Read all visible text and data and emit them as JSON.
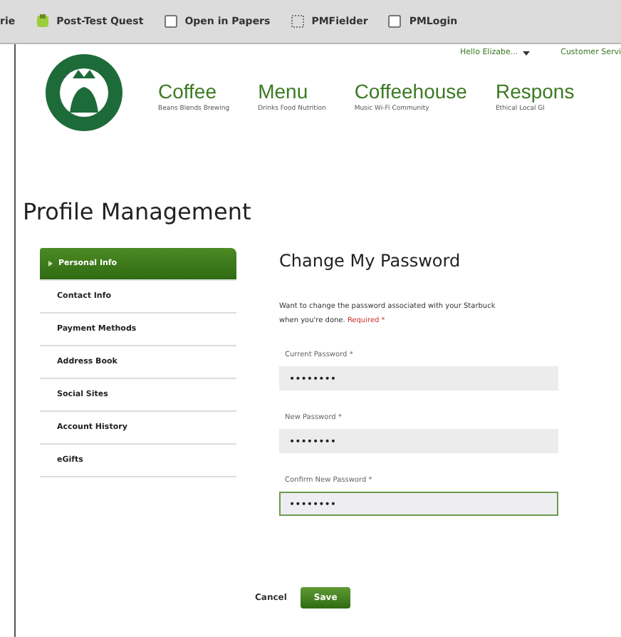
{
  "bookmarks_bar": [
    {
      "label": "rie",
      "kind": "plain"
    },
    {
      "label": "Post-Test Quest",
      "kind": "app"
    },
    {
      "label": "Open in Papers",
      "kind": "page"
    },
    {
      "label": "PMFielder",
      "kind": "dotted"
    },
    {
      "label": "PMLogin",
      "kind": "page"
    }
  ],
  "header": {
    "user_menu": "Hello Elizabe...",
    "customer_service": "Customer Servi",
    "nav": [
      {
        "title": "Coffee",
        "subtitle": "Beans Blends Brewing"
      },
      {
        "title": "Menu",
        "subtitle": "Drinks Food Nutrition"
      },
      {
        "title": "Coffeehouse",
        "subtitle": "Music Wi-Fi Community"
      },
      {
        "title": "Respons",
        "subtitle": "Ethical Local Gl"
      }
    ]
  },
  "page_title": "Profile Management",
  "sidebar": {
    "items": [
      {
        "label": "Personal Info",
        "selected": true
      },
      {
        "label": "Contact Info",
        "selected": false
      },
      {
        "label": "Payment Methods",
        "selected": false
      },
      {
        "label": "Address Book",
        "selected": false
      },
      {
        "label": "Social Sites",
        "selected": false
      },
      {
        "label": "Account History",
        "selected": false
      },
      {
        "label": "eGifts",
        "selected": false
      }
    ]
  },
  "form": {
    "title": "Change My Password",
    "description": "Want to change the password associated with your Starbuck",
    "description_line_2": "when you're done.",
    "required_note": "Required *",
    "fields": [
      {
        "label": "Current Password *",
        "value": "••••••••",
        "focused": false
      },
      {
        "label": "New Password *",
        "value": "••••••••",
        "focused": false
      },
      {
        "label": "Confirm New Password *",
        "value": "••••••••",
        "focused": true
      }
    ],
    "buttons": [
      {
        "label": "Cancel",
        "kind": "link"
      },
      {
        "label": "Save",
        "kind": "primary"
      }
    ]
  }
}
